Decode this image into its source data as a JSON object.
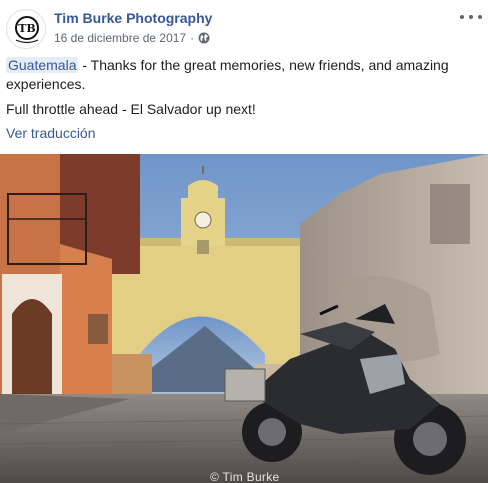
{
  "post": {
    "author": "Tim Burke Photography",
    "date": "16 de diciembre de 2017",
    "separator": "·",
    "privacy_icon": "globe-icon",
    "more_icon": "more-options-icon",
    "avatar_icon": "tim-burke-photography-logo",
    "hashtag": "Guatemala",
    "line1_rest": " - Thanks for the great memories, new friends, and amazing experiences.",
    "line2": "Full throttle ahead - El Salvador up next!",
    "translate_link": "Ver traducción",
    "photo": {
      "description_icon": "motorcycle-photo",
      "watermark": "© Tim Burke"
    }
  },
  "colors": {
    "link": "#365899",
    "meta": "#606770",
    "hashtag_bg": "#e6ecf5"
  }
}
